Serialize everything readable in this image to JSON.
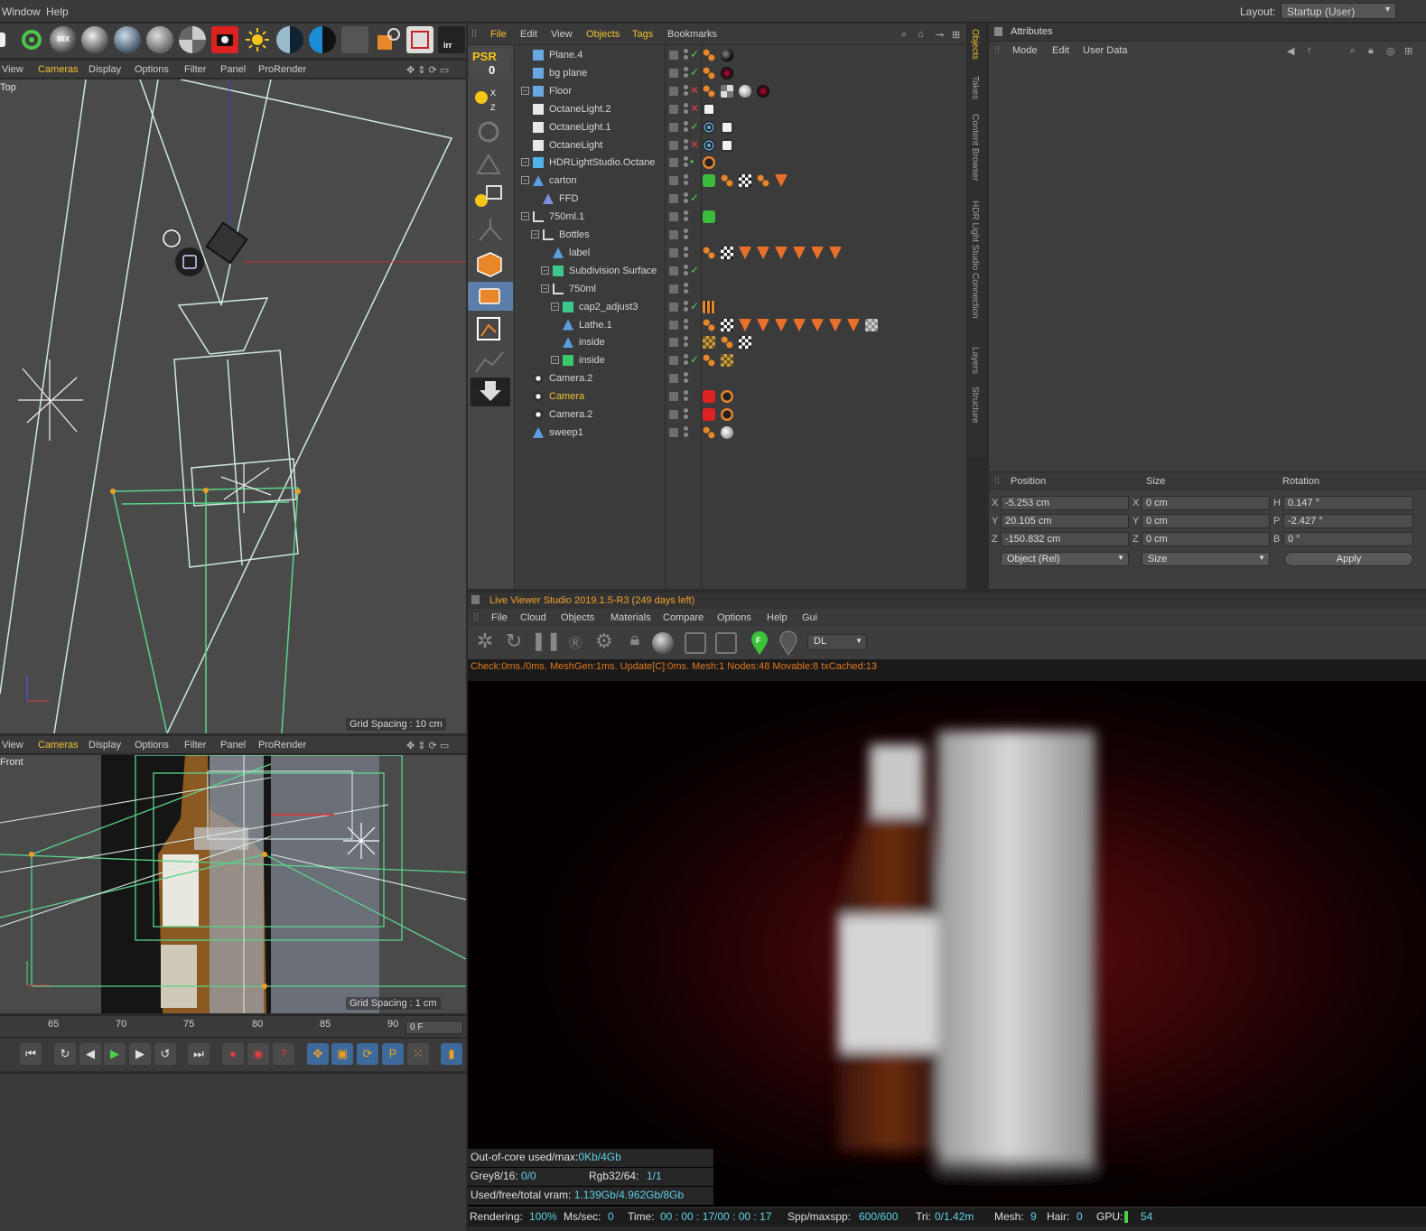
{
  "menubar": {
    "items": [
      "Window",
      "Help"
    ],
    "layout_label": "Layout:",
    "layout_value": "Startup (User)"
  },
  "viewport_menu": [
    "View",
    "Cameras",
    "Display",
    "Options",
    "Filter",
    "Panel",
    "ProRender"
  ],
  "viewport_top": {
    "label": "Top",
    "grid": "Grid Spacing : 10 cm"
  },
  "viewport_front": {
    "label": "Front",
    "grid": "Grid Spacing : 1 cm"
  },
  "object_manager": {
    "menu": [
      "File",
      "Edit",
      "View",
      "Objects",
      "Tags",
      "Bookmarks"
    ],
    "palette_label": "PSR",
    "palette_value": "0",
    "objects": [
      {
        "name": "Plane.4",
        "icon": "plane-icon",
        "status": "check"
      },
      {
        "name": "bg plane",
        "icon": "plane-icon",
        "status": "check"
      },
      {
        "name": "Floor",
        "icon": "floor-icon",
        "status": "cross"
      },
      {
        "name": "OctaneLight.2",
        "icon": "light-icon",
        "status": "cross"
      },
      {
        "name": "OctaneLight.1",
        "icon": "light-icon",
        "status": "check"
      },
      {
        "name": "OctaneLight",
        "icon": "light-icon",
        "status": "cross"
      },
      {
        "name": "HDRLightStudio.Octane",
        "icon": "hdr-icon",
        "status": "dot"
      },
      {
        "name": "carton",
        "icon": "polygon-icon",
        "status": ""
      },
      {
        "name": "FFD",
        "icon": "ffd-icon",
        "status": "check"
      },
      {
        "name": "750ml.1",
        "icon": "null-icon",
        "status": ""
      },
      {
        "name": "Bottles",
        "icon": "null-icon",
        "status": ""
      },
      {
        "name": "label",
        "icon": "polygon-icon",
        "status": ""
      },
      {
        "name": "Subdivision Surface",
        "icon": "subdiv-icon",
        "status": "check"
      },
      {
        "name": "750ml",
        "icon": "null-icon",
        "status": ""
      },
      {
        "name": "cap2_adjust3",
        "icon": "subdiv-icon",
        "status": "check"
      },
      {
        "name": "Lathe.1",
        "icon": "polygon-icon",
        "status": ""
      },
      {
        "name": "inside",
        "icon": "polygon-icon",
        "status": ""
      },
      {
        "name": "inside",
        "icon": "bottle-icon",
        "status": "check"
      },
      {
        "name": "Camera.2",
        "icon": "camera-icon",
        "status": ""
      },
      {
        "name": "Camera",
        "icon": "camera-icon",
        "status": "",
        "selected": true
      },
      {
        "name": "Camera.2",
        "icon": "camera-icon",
        "status": ""
      },
      {
        "name": "sweep1",
        "icon": "polygon-icon",
        "status": ""
      }
    ]
  },
  "side_tabs": [
    "Objects",
    "Takes",
    "Content Browser",
    "HDR Light Studio Connection",
    "Layers",
    "Structure"
  ],
  "attributes": {
    "title": "Attributes",
    "menu": [
      "Mode",
      "Edit",
      "User Data"
    ],
    "headers": [
      "Position",
      "Size",
      "Rotation"
    ],
    "position": {
      "X": "-5.253 cm",
      "Y": "20.105 cm",
      "Z": "-150.832 cm"
    },
    "size": {
      "X": "0 cm",
      "Y": "0 cm",
      "Z": "0 cm"
    },
    "rotation": {
      "H": "0.147 °",
      "P": "-2.427 °",
      "B": "0 °"
    },
    "mode_dropdown": "Object (Rel)",
    "size_dropdown": "Size",
    "apply_label": "Apply"
  },
  "live_viewer": {
    "title": "Live Viewer Studio 2019.1.5-R3 (249 days left)",
    "menu": [
      "File",
      "Cloud",
      "Objects",
      "Materials",
      "Compare",
      "Options",
      "Help",
      "Gui"
    ],
    "mode": "DL",
    "stats": "Check:0ms./0ms. MeshGen:1ms. Update[C]:0ms. Mesh:1 Nodes:48 Movable:8 txCached:13",
    "info": {
      "ooc_label": "Out-of-core used/max:",
      "ooc_value": "0Kb/4Gb",
      "grey_label": "Grey8/16:",
      "grey_value": "0/0",
      "rgb_label": "Rgb32/64:",
      "rgb_value": "1/1",
      "vram_label": "Used/free/total vram:",
      "vram_value": "1.139Gb/4.962Gb/8Gb"
    },
    "status": {
      "rendering_label": "Rendering:",
      "rendering_value": "100%",
      "ms_label": "Ms/sec:",
      "ms_value": "0",
      "time_label": "Time:",
      "time_value": "00 : 00 : 17/00 : 00 : 17",
      "spp_label": "Spp/maxspp:",
      "spp_value": "600/600",
      "tri_label": "Tri:",
      "tri_value": "0/1.42m",
      "mesh_label": "Mesh:",
      "mesh_value": "9",
      "hair_label": "Hair:",
      "hair_value": "0",
      "gpu_label": "GPU:",
      "gpu_value": "54"
    }
  },
  "timeline": {
    "ticks": [
      "65",
      "70",
      "75",
      "80",
      "85",
      "90"
    ],
    "frame": "0 F"
  },
  "colors": {
    "accent": "#f1c232",
    "cyan": "#5fd0e6",
    "wire": "#5bd38a"
  }
}
